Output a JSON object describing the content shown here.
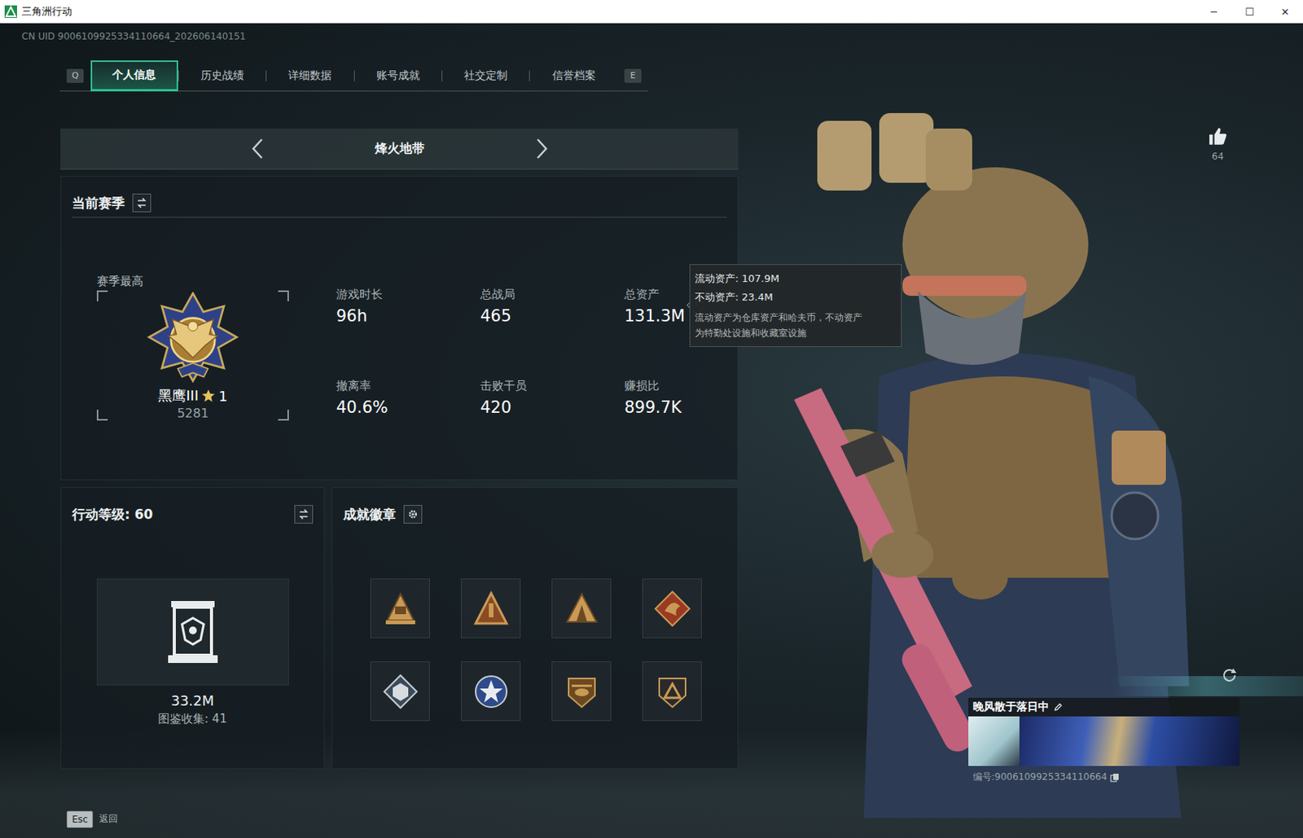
{
  "window": {
    "title": "三角洲行动",
    "controls": [
      "─",
      "☐",
      "✕"
    ]
  },
  "uid": "CN UID 9006109925334110664_202606140151",
  "tabs": {
    "prev_key": "Q",
    "next_key": "E",
    "items": [
      {
        "label": "个人信息",
        "selected": true
      },
      {
        "label": "历史战绩",
        "selected": false
      },
      {
        "label": "详细数据",
        "selected": false
      },
      {
        "label": "账号成就",
        "selected": false
      },
      {
        "label": "社交定制",
        "selected": false
      },
      {
        "label": "信誉档案",
        "selected": false
      }
    ]
  },
  "mode": {
    "label": "烽火地带"
  },
  "season": {
    "title": "当前赛季",
    "best_label": "赛季最高",
    "rank": "黑鹰III",
    "star_number": "1",
    "score": "5281",
    "stats": [
      {
        "label": "游戏时长",
        "value": "96h"
      },
      {
        "label": "总战局",
        "value": "465"
      },
      {
        "label": "总资产",
        "value": "131.3M",
        "help": "?"
      },
      {
        "label": "撤离率",
        "value": "40.6%"
      },
      {
        "label": "击败干员",
        "value": "420"
      },
      {
        "label": "赚损比",
        "value": "899.7K"
      }
    ]
  },
  "tooltip": {
    "lines": [
      "流动资产: 107.9M",
      "不动资产: 23.4M"
    ],
    "note": [
      "流动资产为仓库资产和哈夫币，不动资产",
      "为特勤处设施和收藏室设施"
    ]
  },
  "level": {
    "title": "行动等级: 60",
    "value": "33.2M",
    "collection": "图鉴收集: 41"
  },
  "badges": {
    "title": "成就徽章",
    "items": [
      {
        "kind": "crest"
      },
      {
        "kind": "rank"
      },
      {
        "kind": "camp"
      },
      {
        "kind": "dragon"
      },
      {
        "kind": "cube"
      },
      {
        "kind": "star"
      },
      {
        "kind": "heli"
      },
      {
        "kind": "delta"
      }
    ]
  },
  "likes": {
    "count": "64"
  },
  "card": {
    "name": "晚风散于落日中",
    "id": "编号:9006109925334110664"
  },
  "footer": {
    "key": "Esc",
    "label": "返回"
  }
}
